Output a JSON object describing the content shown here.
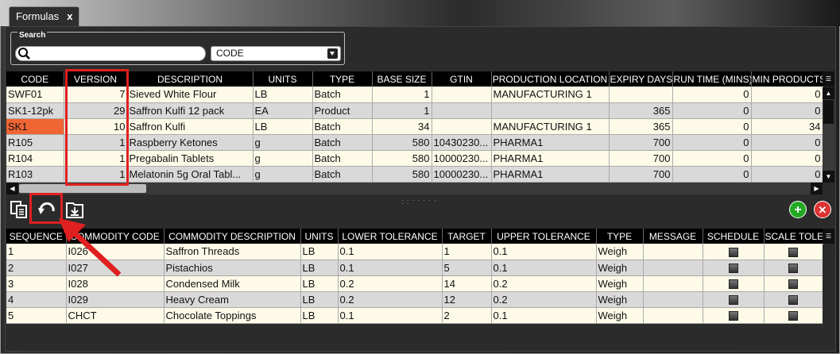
{
  "tab": {
    "label": "Formulas",
    "close": "x"
  },
  "search": {
    "legend": "Search",
    "value": "",
    "field_selected": "CODE"
  },
  "formulas": {
    "columns": [
      "CODE",
      "VERSION",
      "DESCRIPTION",
      "UNITS",
      "TYPE",
      "BASE SIZE",
      "GTIN",
      "PRODUCTION LOCATION",
      "EXPIRY DAYS",
      "RUN TIME (MINS)",
      "MIN PRODUCTS"
    ],
    "rows": [
      {
        "code": "SWF01",
        "version": "7",
        "description": "Sieved White Flour",
        "units": "LB",
        "type": "Batch",
        "base_size": "1",
        "gtin": "",
        "location": "MANUFACTURING 1",
        "expiry": "",
        "run_time": "0",
        "min_products": "0"
      },
      {
        "code": "SK1-12pk",
        "version": "29",
        "description": "Saffron Kulfi 12 pack",
        "units": "EA",
        "type": "Product",
        "base_size": "1",
        "gtin": "",
        "location": "",
        "expiry": "365",
        "run_time": "0",
        "min_products": "0"
      },
      {
        "code": "SK1",
        "version": "10",
        "description": "Saffron Kulfi",
        "units": "LB",
        "type": "Batch",
        "base_size": "34",
        "gtin": "",
        "location": "MANUFACTURING 1",
        "expiry": "365",
        "run_time": "0",
        "min_products": "34"
      },
      {
        "code": "R105",
        "version": "1",
        "description": "Raspberry Ketones",
        "units": "g",
        "type": "Batch",
        "base_size": "580",
        "gtin": "10430230...",
        "location": "PHARMA1",
        "expiry": "700",
        "run_time": "0",
        "min_products": "0"
      },
      {
        "code": "R104",
        "version": "1",
        "description": "Pregabalin Tablets",
        "units": "g",
        "type": "Batch",
        "base_size": "580",
        "gtin": "10000230...",
        "location": "PHARMA1",
        "expiry": "700",
        "run_time": "0",
        "min_products": "0"
      },
      {
        "code": "R103",
        "version": "1",
        "description": "Melatonin 5g Oral Tabl...",
        "units": "g",
        "type": "Batch",
        "base_size": "580",
        "gtin": "10000230...",
        "location": "PHARMA1",
        "expiry": "700",
        "run_time": "0",
        "min_products": "0"
      }
    ]
  },
  "ingredients": {
    "columns": [
      "SEQUENCE",
      "COMMODITY CODE",
      "COMMODITY DESCRIPTION",
      "UNITS",
      "LOWER TOLERANCE",
      "TARGET",
      "UPPER TOLERANCE",
      "TYPE",
      "MESSAGE",
      "SCHEDULE",
      "SCALE TOLE"
    ],
    "rows": [
      {
        "seq": "1",
        "code": "I026",
        "description": "Saffron Threads",
        "units": "LB",
        "lower": "0.1",
        "target": "1",
        "upper": "0.1",
        "type": "Weigh",
        "message": ""
      },
      {
        "seq": "2",
        "code": "I027",
        "description": "Pistachios",
        "units": "LB",
        "lower": "0.1",
        "target": "5",
        "upper": "0.1",
        "type": "Weigh",
        "message": ""
      },
      {
        "seq": "3",
        "code": "I028",
        "description": "Condensed Milk",
        "units": "LB",
        "lower": "0.2",
        "target": "14",
        "upper": "0.2",
        "type": "Weigh",
        "message": ""
      },
      {
        "seq": "4",
        "code": "I029",
        "description": "Heavy Cream",
        "units": "LB",
        "lower": "0.2",
        "target": "12",
        "upper": "0.2",
        "type": "Weigh",
        "message": ""
      },
      {
        "seq": "5",
        "code": "CHCT",
        "description": "Chocolate Toppings",
        "units": "LB",
        "lower": "0.1",
        "target": "2",
        "upper": "0.1",
        "type": "Weigh",
        "message": ""
      }
    ]
  },
  "toolbar": {
    "add": "+",
    "delete": "✕"
  },
  "colors": {
    "highlight": "#ef6534",
    "annotation": "#e02020",
    "add": "#22aa22",
    "delete": "#dd3333"
  },
  "icons": [
    "copy-icon",
    "undo-icon",
    "download-icon",
    "search-icon",
    "column-chooser-icon"
  ]
}
